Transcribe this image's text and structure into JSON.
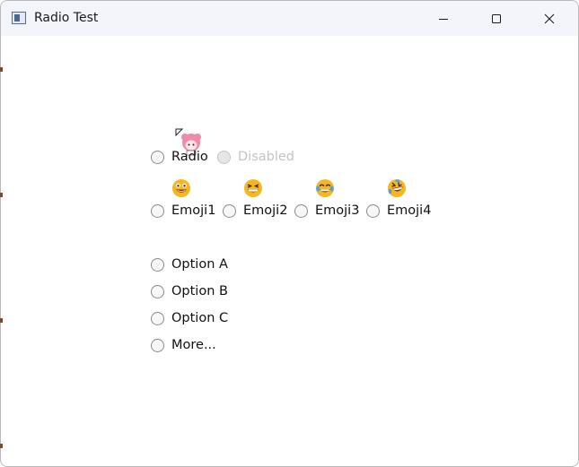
{
  "window": {
    "title": "Radio Test",
    "icon": "window-app-icon",
    "controls": [
      "minimize-icon",
      "maximize-icon",
      "close-icon"
    ]
  },
  "radios": {
    "row1": [
      {
        "label": "Radio",
        "enabled": true,
        "checked": false
      },
      {
        "label": "Disabled",
        "enabled": false,
        "checked": false
      }
    ],
    "emoji_row": [
      {
        "label": "Emoji1",
        "emoji": "grinning-face-wide-eyes",
        "checked": false
      },
      {
        "label": "Emoji2",
        "emoji": "grinning-squinting-face",
        "checked": false
      },
      {
        "label": "Emoji3",
        "emoji": "face-with-tears-of-joy",
        "checked": false
      },
      {
        "label": "Emoji4",
        "emoji": "rolling-on-floor-laughing",
        "checked": false
      }
    ],
    "options": [
      {
        "label": "Option A",
        "checked": false
      },
      {
        "label": "Option B",
        "checked": false
      },
      {
        "label": "Option C",
        "checked": false
      },
      {
        "label": "More...",
        "checked": false
      }
    ]
  },
  "decorations": {
    "sticker": "pink-haired-character-sticker"
  },
  "colors": {
    "titlebar_bg": "#f3f5fb",
    "radio_border": "#8a8a8a",
    "disabled_text": "#c4c4c4",
    "emoji_yellow": "#f6b61e"
  }
}
